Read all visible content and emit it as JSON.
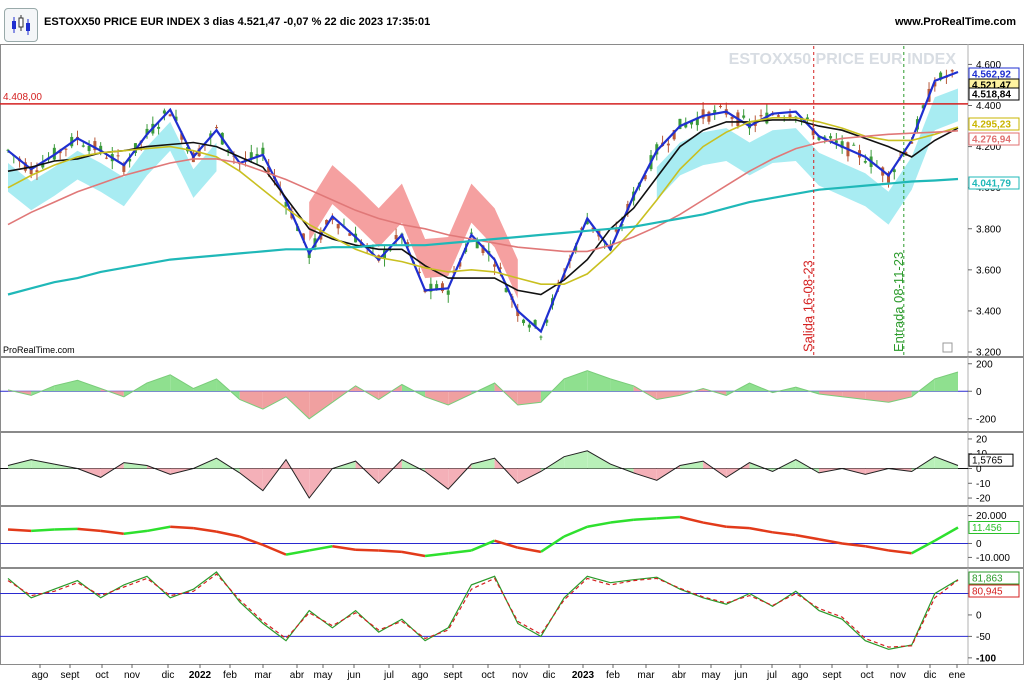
{
  "header": {
    "title": "ESTOXX50 PRICE EUR INDEX 3 dias 4.521,47 -0,07 % 22 dic 2023 17:35:01",
    "site": "www.ProRealTime.com",
    "logo_icon": "candlestick-logo-icon"
  },
  "chart_data": [
    {
      "type": "candlestick",
      "title": "ESTOXX50 PRICE EUR INDEX",
      "watermark": "ESTOXX50 PRICE EUR INDEX",
      "source_label": "ProRealTime.com",
      "ylim": [
        3200,
        4680
      ],
      "y_ticks": [
        {
          "v": 3200,
          "t": "3.200"
        },
        {
          "v": 3400,
          "t": "3.400"
        },
        {
          "v": 3600,
          "t": "3.600"
        },
        {
          "v": 3800,
          "t": "3.800"
        },
        {
          "v": 4000,
          "t": "4.000"
        },
        {
          "v": 4200,
          "t": "4.200"
        },
        {
          "v": 4400,
          "t": "4.400"
        },
        {
          "v": 4600,
          "t": "4.600"
        }
      ],
      "resistance": {
        "value": 4408,
        "label": "4.408,00",
        "color": "#d42020"
      },
      "value_tags": [
        {
          "text": "4.562,92",
          "color": "#1f2fd0"
        },
        {
          "text": "4.521,47",
          "color": "#000000"
        },
        {
          "text": "4.518,84",
          "color": "#000000"
        },
        {
          "text": "4.295,23",
          "color": "#c9b400"
        },
        {
          "text": "4.276,94",
          "color": "#e07070"
        },
        {
          "text": "4.041,79",
          "color": "#1fb8b8"
        }
      ],
      "events": [
        {
          "label": "Salida 16-08-23",
          "date": "2023-08-16",
          "color": "#d42020"
        },
        {
          "label": "Entrada 08-11-23",
          "date": "2023-11-08",
          "color": "#2a9a2a"
        }
      ],
      "series": [
        {
          "name": "",
          "color": "#1f2fd0",
          "values": [
            4180,
            4090,
            4160,
            4240,
            4180,
            4110,
            4260,
            4380,
            4150,
            4280,
            4120,
            4160,
            3940,
            3680,
            3860,
            3760,
            3650,
            3770,
            3500,
            3510,
            3770,
            3650,
            3400,
            3300,
            3580,
            3850,
            3700,
            3960,
            4180,
            4300,
            4350,
            4370,
            4300,
            4360,
            4370,
            4250,
            4200,
            4150,
            4060,
            4230,
            4520,
            4563
          ]
        },
        {
          "name": "",
          "color": "#111111",
          "values": [
            4080,
            4100,
            4130,
            4140,
            4170,
            4180,
            4200,
            4210,
            4220,
            4200,
            4150,
            4100,
            3950,
            3800,
            3750,
            3720,
            3700,
            3700,
            3620,
            3560,
            3560,
            3560,
            3500,
            3480,
            3550,
            3650,
            3800,
            3900,
            4050,
            4200,
            4280,
            4320,
            4320,
            4330,
            4330,
            4300,
            4280,
            4240,
            4200,
            4150,
            4230,
            4290
          ]
        },
        {
          "name": "",
          "color": "#c9c020",
          "values": [
            4000,
            4060,
            4110,
            4150,
            4170,
            4180,
            4190,
            4200,
            4180,
            4150,
            4080,
            3990,
            3900,
            3820,
            3760,
            3700,
            3660,
            3640,
            3610,
            3590,
            3600,
            3590,
            3560,
            3530,
            3530,
            3580,
            3680,
            3800,
            3940,
            4090,
            4200,
            4270,
            4320,
            4340,
            4340,
            4320,
            4290,
            4250,
            4230,
            4230,
            4260,
            4295
          ]
        },
        {
          "name": "",
          "color": "#e07878",
          "values": [
            3820,
            3880,
            3930,
            3980,
            4020,
            4060,
            4090,
            4120,
            4140,
            4140,
            4120,
            4080,
            4040,
            3990,
            3940,
            3890,
            3850,
            3820,
            3800,
            3770,
            3750,
            3730,
            3710,
            3700,
            3690,
            3690,
            3720,
            3760,
            3810,
            3870,
            3940,
            4010,
            4080,
            4140,
            4190,
            4220,
            4240,
            4250,
            4260,
            4265,
            4270,
            4277
          ]
        },
        {
          "name": "",
          "color": "#1fb8b8",
          "values": [
            3480,
            3510,
            3540,
            3560,
            3590,
            3610,
            3630,
            3650,
            3660,
            3670,
            3680,
            3690,
            3700,
            3700,
            3710,
            3710,
            3720,
            3720,
            3720,
            3730,
            3740,
            3750,
            3760,
            3770,
            3780,
            3790,
            3800,
            3810,
            3830,
            3850,
            3870,
            3900,
            3930,
            3950,
            3970,
            3990,
            4000,
            4010,
            4020,
            4030,
            4035,
            4042
          ]
        }
      ]
    },
    {
      "type": "area",
      "ylim": [
        -260,
        220
      ],
      "y_ticks": [
        {
          "v": 200,
          "t": "200"
        },
        {
          "v": 0,
          "t": "0"
        },
        {
          "v": -200,
          "t": "-200"
        }
      ],
      "baseline": 0,
      "values": [
        10,
        -30,
        40,
        80,
        20,
        -40,
        60,
        120,
        20,
        90,
        -60,
        -130,
        -40,
        -200,
        -80,
        40,
        -60,
        50,
        -40,
        -100,
        -20,
        60,
        -100,
        -80,
        90,
        150,
        90,
        40,
        -60,
        -30,
        20,
        -30,
        60,
        -10,
        30,
        -20,
        -40,
        -60,
        -80,
        -40,
        90,
        140
      ]
    },
    {
      "type": "area",
      "ylim": [
        -22,
        22
      ],
      "y_ticks": [
        {
          "v": 20,
          "t": "20"
        },
        {
          "v": 10,
          "t": "10"
        },
        {
          "v": 0,
          "t": "0"
        },
        {
          "v": -10,
          "t": "-10"
        },
        {
          "v": -20,
          "t": "-20"
        }
      ],
      "value_tags": [
        {
          "text": "1,5765",
          "color": "#000000"
        }
      ],
      "baseline": 0,
      "values": [
        2,
        6,
        3,
        0,
        -6,
        4,
        2,
        -4,
        0,
        7,
        -3,
        -15,
        6,
        -20,
        0,
        5,
        -10,
        6,
        -2,
        -14,
        3,
        7,
        -10,
        -2,
        8,
        12,
        3,
        -3,
        -8,
        2,
        5,
        -6,
        4,
        -2,
        6,
        -3,
        0,
        -4,
        0,
        -2,
        8,
        2
      ]
    },
    {
      "type": "line",
      "ylim": [
        -14000,
        24000
      ],
      "y_ticks": [
        {
          "v": 20000,
          "t": "20.000"
        },
        {
          "v": 0,
          "t": "0"
        },
        {
          "v": -10000,
          "t": "-10.000"
        }
      ],
      "value_tags": [
        {
          "text": "11.456",
          "color": "#2ac02a"
        }
      ],
      "baseline": 0,
      "values": [
        10000,
        9000,
        10000,
        10500,
        9000,
        7000,
        9000,
        12000,
        11000,
        8500,
        5000,
        -1000,
        -8000,
        -5000,
        -2000,
        -4500,
        -5000,
        -6000,
        -9000,
        -7000,
        -5000,
        2000,
        -3000,
        -6000,
        5000,
        12000,
        15000,
        17000,
        18000,
        19000,
        15000,
        12000,
        11000,
        8000,
        6000,
        3000,
        0,
        -2000,
        -5000,
        -7000,
        2000,
        11456
      ],
      "colors": {
        "rising": "#2ee02e",
        "falling": "#e23a1a"
      }
    },
    {
      "type": "line",
      "ylim": [
        -105,
        100
      ],
      "y_ticks": [
        {
          "v": 50,
          "t": "50"
        },
        {
          "v": 0,
          "t": "0"
        },
        {
          "v": -50,
          "t": "-50"
        },
        {
          "v": -100,
          "t": "-100"
        }
      ],
      "value_tags": [
        {
          "text": "81,863",
          "color": "#2a9a2a"
        },
        {
          "text": "80,945",
          "color": "#d42020"
        }
      ],
      "levels": [
        80,
        20
      ],
      "series": [
        {
          "name": "",
          "color": "#2a9a2a",
          "values": [
            85,
            40,
            60,
            80,
            40,
            70,
            90,
            40,
            60,
            100,
            30,
            -20,
            -60,
            10,
            -30,
            10,
            -40,
            -10,
            -60,
            -30,
            70,
            90,
            -20,
            -50,
            40,
            90,
            75,
            82,
            88,
            60,
            40,
            25,
            50,
            20,
            55,
            10,
            -10,
            -60,
            -80,
            -70,
            50,
            82
          ]
        },
        {
          "name": "",
          "color": "#d42020",
          "values": [
            80,
            45,
            55,
            75,
            45,
            65,
            85,
            45,
            55,
            95,
            35,
            -15,
            -55,
            5,
            -25,
            5,
            -35,
            -15,
            -55,
            -35,
            60,
            85,
            -15,
            -45,
            35,
            85,
            70,
            80,
            85,
            62,
            42,
            28,
            45,
            22,
            50,
            15,
            -5,
            -55,
            -75,
            -72,
            40,
            81
          ]
        }
      ]
    }
  ],
  "x_axis": {
    "labels": [
      {
        "t": "ago",
        "bold": false
      },
      {
        "t": "sept",
        "bold": false
      },
      {
        "t": "oct",
        "bold": false
      },
      {
        "t": "nov",
        "bold": false
      },
      {
        "t": "dic",
        "bold": false
      },
      {
        "t": "2022",
        "bold": true
      },
      {
        "t": "feb",
        "bold": false
      },
      {
        "t": "mar",
        "bold": false
      },
      {
        "t": "abr",
        "bold": false
      },
      {
        "t": "may",
        "bold": false
      },
      {
        "t": "jun",
        "bold": false
      },
      {
        "t": "jul",
        "bold": false
      },
      {
        "t": "ago",
        "bold": false
      },
      {
        "t": "sept",
        "bold": false
      },
      {
        "t": "oct",
        "bold": false
      },
      {
        "t": "nov",
        "bold": false
      },
      {
        "t": "dic",
        "bold": false
      },
      {
        "t": "2023",
        "bold": true
      },
      {
        "t": "feb",
        "bold": false
      },
      {
        "t": "mar",
        "bold": false
      },
      {
        "t": "abr",
        "bold": false
      },
      {
        "t": "may",
        "bold": false
      },
      {
        "t": "jun",
        "bold": false
      },
      {
        "t": "jul",
        "bold": false
      },
      {
        "t": "ago",
        "bold": false
      },
      {
        "t": "sept",
        "bold": false
      },
      {
        "t": "oct",
        "bold": false
      },
      {
        "t": "nov",
        "bold": false
      },
      {
        "t": "dic",
        "bold": false
      },
      {
        "t": "ene",
        "bold": false
      }
    ]
  }
}
